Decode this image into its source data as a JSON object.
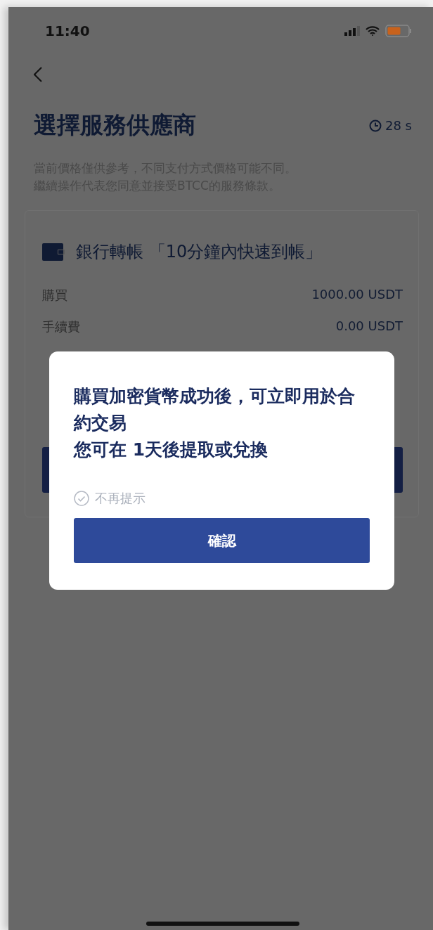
{
  "status_bar": {
    "time": "11:40"
  },
  "header": {
    "title": "選擇服務供應商",
    "timer": "28 s"
  },
  "notice": [
    "當前價格僅供參考，不同支付方式價格可能不同。",
    "繼續操作代表您同意並接受BTCC的服務條款。"
  ],
  "provider_card": {
    "title": "銀行轉帳 「10分鐘內快速到帳」",
    "rows": [
      {
        "label": "購買",
        "value": "1000.00 USDT"
      },
      {
        "label": "手續費",
        "value": "0.00 USDT"
      }
    ]
  },
  "dialog": {
    "lines": [
      "購買加密貨幣成功後，可立即用於合約交易",
      "您可在 1天後提取或兌換"
    ],
    "dont_remind": {
      "label": "不再提示",
      "checked": false
    },
    "confirm_button": "確認"
  }
}
